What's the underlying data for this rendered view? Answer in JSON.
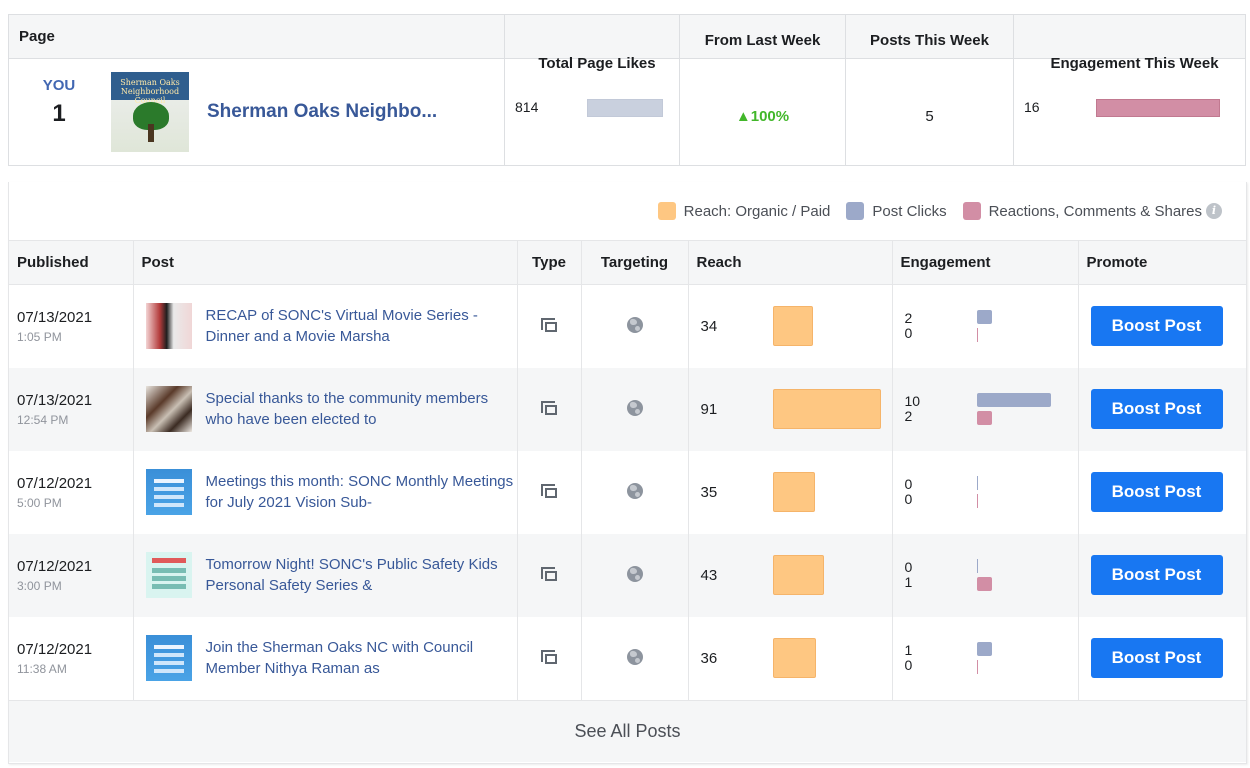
{
  "summary": {
    "headers": {
      "page": "Page",
      "total_likes": "Total Page Likes",
      "from_last_week": "From Last Week",
      "posts_this_week": "Posts This Week",
      "engagement_this_week": "Engagement This Week"
    },
    "row": {
      "you_label": "YOU",
      "rank": "1",
      "page_name": "Sherman Oaks Neighbo...",
      "thumb_text": "Sherman Oaks Neighborhood Council",
      "total_likes": "814",
      "total_likes_bar_fraction": 0.65,
      "from_last_week": "▲100%",
      "posts_this_week": "5",
      "engagement_this_week": "16",
      "engagement_bar_fraction": 1.0
    }
  },
  "legend": {
    "reach": "Reach: Organic / Paid",
    "post_clicks": "Post Clicks",
    "reactions": "Reactions, Comments & Shares",
    "colors": {
      "reach": "#fec782",
      "post_clicks": "#9ca9c9",
      "reactions": "#d28ea5"
    }
  },
  "table": {
    "headers": {
      "published": "Published",
      "post": "Post",
      "type": "Type",
      "targeting": "Targeting",
      "reach": "Reach",
      "engagement": "Engagement",
      "promote": "Promote"
    },
    "boost_label": "Boost Post",
    "rows": [
      {
        "date": "07/13/2021",
        "time": "1:05 PM",
        "post": "RECAP of SONC's Virtual Movie Series - Dinner and a Movie Marsha",
        "reach": "34",
        "clicks": "2",
        "reactions": "0"
      },
      {
        "date": "07/13/2021",
        "time": "12:54 PM",
        "post": "Special thanks to the community members who have been elected to",
        "reach": "91",
        "clicks": "10",
        "reactions": "2"
      },
      {
        "date": "07/12/2021",
        "time": "5:00 PM",
        "post": "Meetings this month: SONC Monthly Meetings for July 2021 Vision Sub-",
        "reach": "35",
        "clicks": "0",
        "reactions": "0"
      },
      {
        "date": "07/12/2021",
        "time": "3:00 PM",
        "post": "Tomorrow Night! SONC's Public Safety Kids Personal Safety Series &",
        "reach": "43",
        "clicks": "0",
        "reactions": "1"
      },
      {
        "date": "07/12/2021",
        "time": "11:38 AM",
        "post": "Join the Sherman Oaks NC with Council Member Nithya Raman as",
        "reach": "36",
        "clicks": "1",
        "reactions": "0"
      }
    ]
  },
  "footer": {
    "see_all": "See All Posts"
  },
  "icons": {
    "type": "post-type-icon",
    "targeting": "globe-icon",
    "info": "info-icon"
  }
}
